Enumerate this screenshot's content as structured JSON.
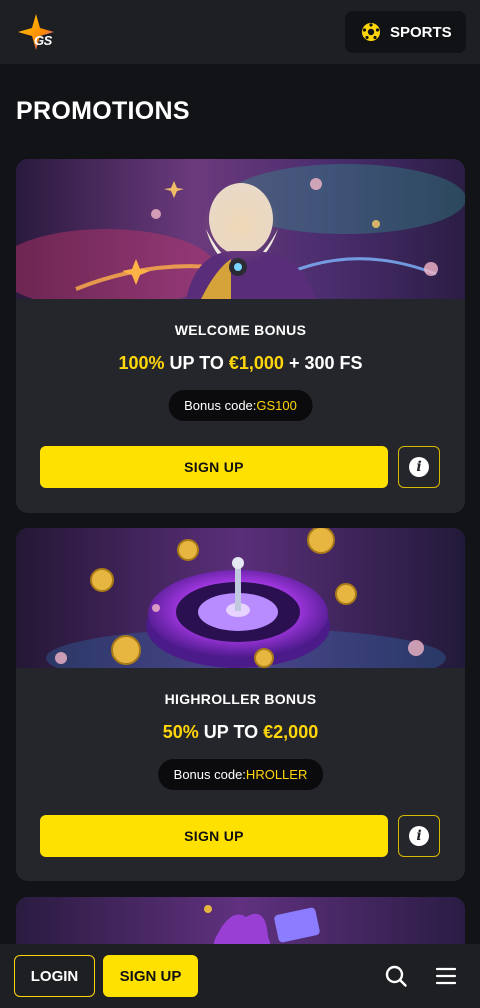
{
  "header": {
    "logo_text": "GS",
    "sports_label": "SPORTS"
  },
  "page": {
    "title": "PROMOTIONS"
  },
  "promotions": [
    {
      "title": "WELCOME BONUS",
      "offer_pct": "100%",
      "offer_mid": " UP TO ",
      "offer_amount": "€1,000",
      "offer_tail": " + 300 FS",
      "code_label": "Bonus code: ",
      "code_value": "GS100",
      "cta": "SIGN UP"
    },
    {
      "title": "HIGHROLLER BONUS",
      "offer_pct": "50%",
      "offer_mid": " UP TO ",
      "offer_amount": "€2,000",
      "offer_tail": "",
      "code_label": "Bonus code: ",
      "code_value": "HROLLER",
      "cta": "SIGN UP"
    }
  ],
  "bottom_bar": {
    "login_label": "LOGIN",
    "signup_label": "SIGN UP"
  },
  "colors": {
    "accent": "#ffe100",
    "highlight_text": "#ffd60a",
    "background": "#121316",
    "card": "#25262b"
  },
  "icons": [
    "logo-star-icon",
    "soccer-ball-icon",
    "info-icon",
    "search-icon",
    "menu-icon"
  ]
}
